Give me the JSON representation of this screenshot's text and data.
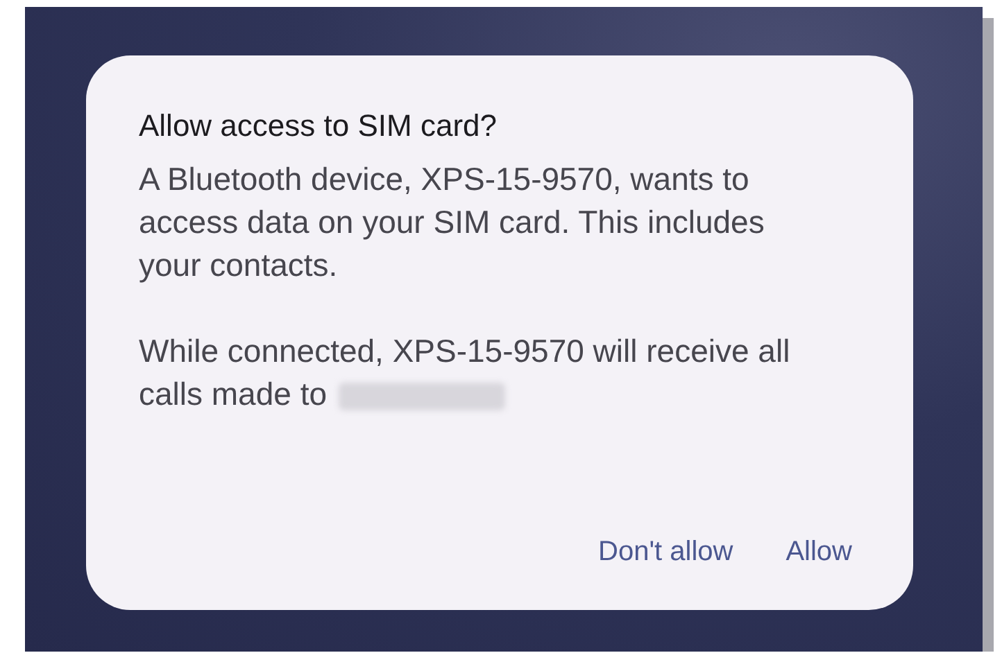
{
  "dialog": {
    "title": "Allow access to SIM card?",
    "paragraphs": [
      {
        "text": "A Bluetooth device, XPS-15-9570, wants to access data on your SIM card. This includes your contacts.",
        "redacted_tail": false
      },
      {
        "text": "While connected, XPS-15-9570 will receive all calls made to",
        "redacted_tail": true
      }
    ],
    "buttons": [
      "Don't allow",
      "Allow"
    ]
  }
}
